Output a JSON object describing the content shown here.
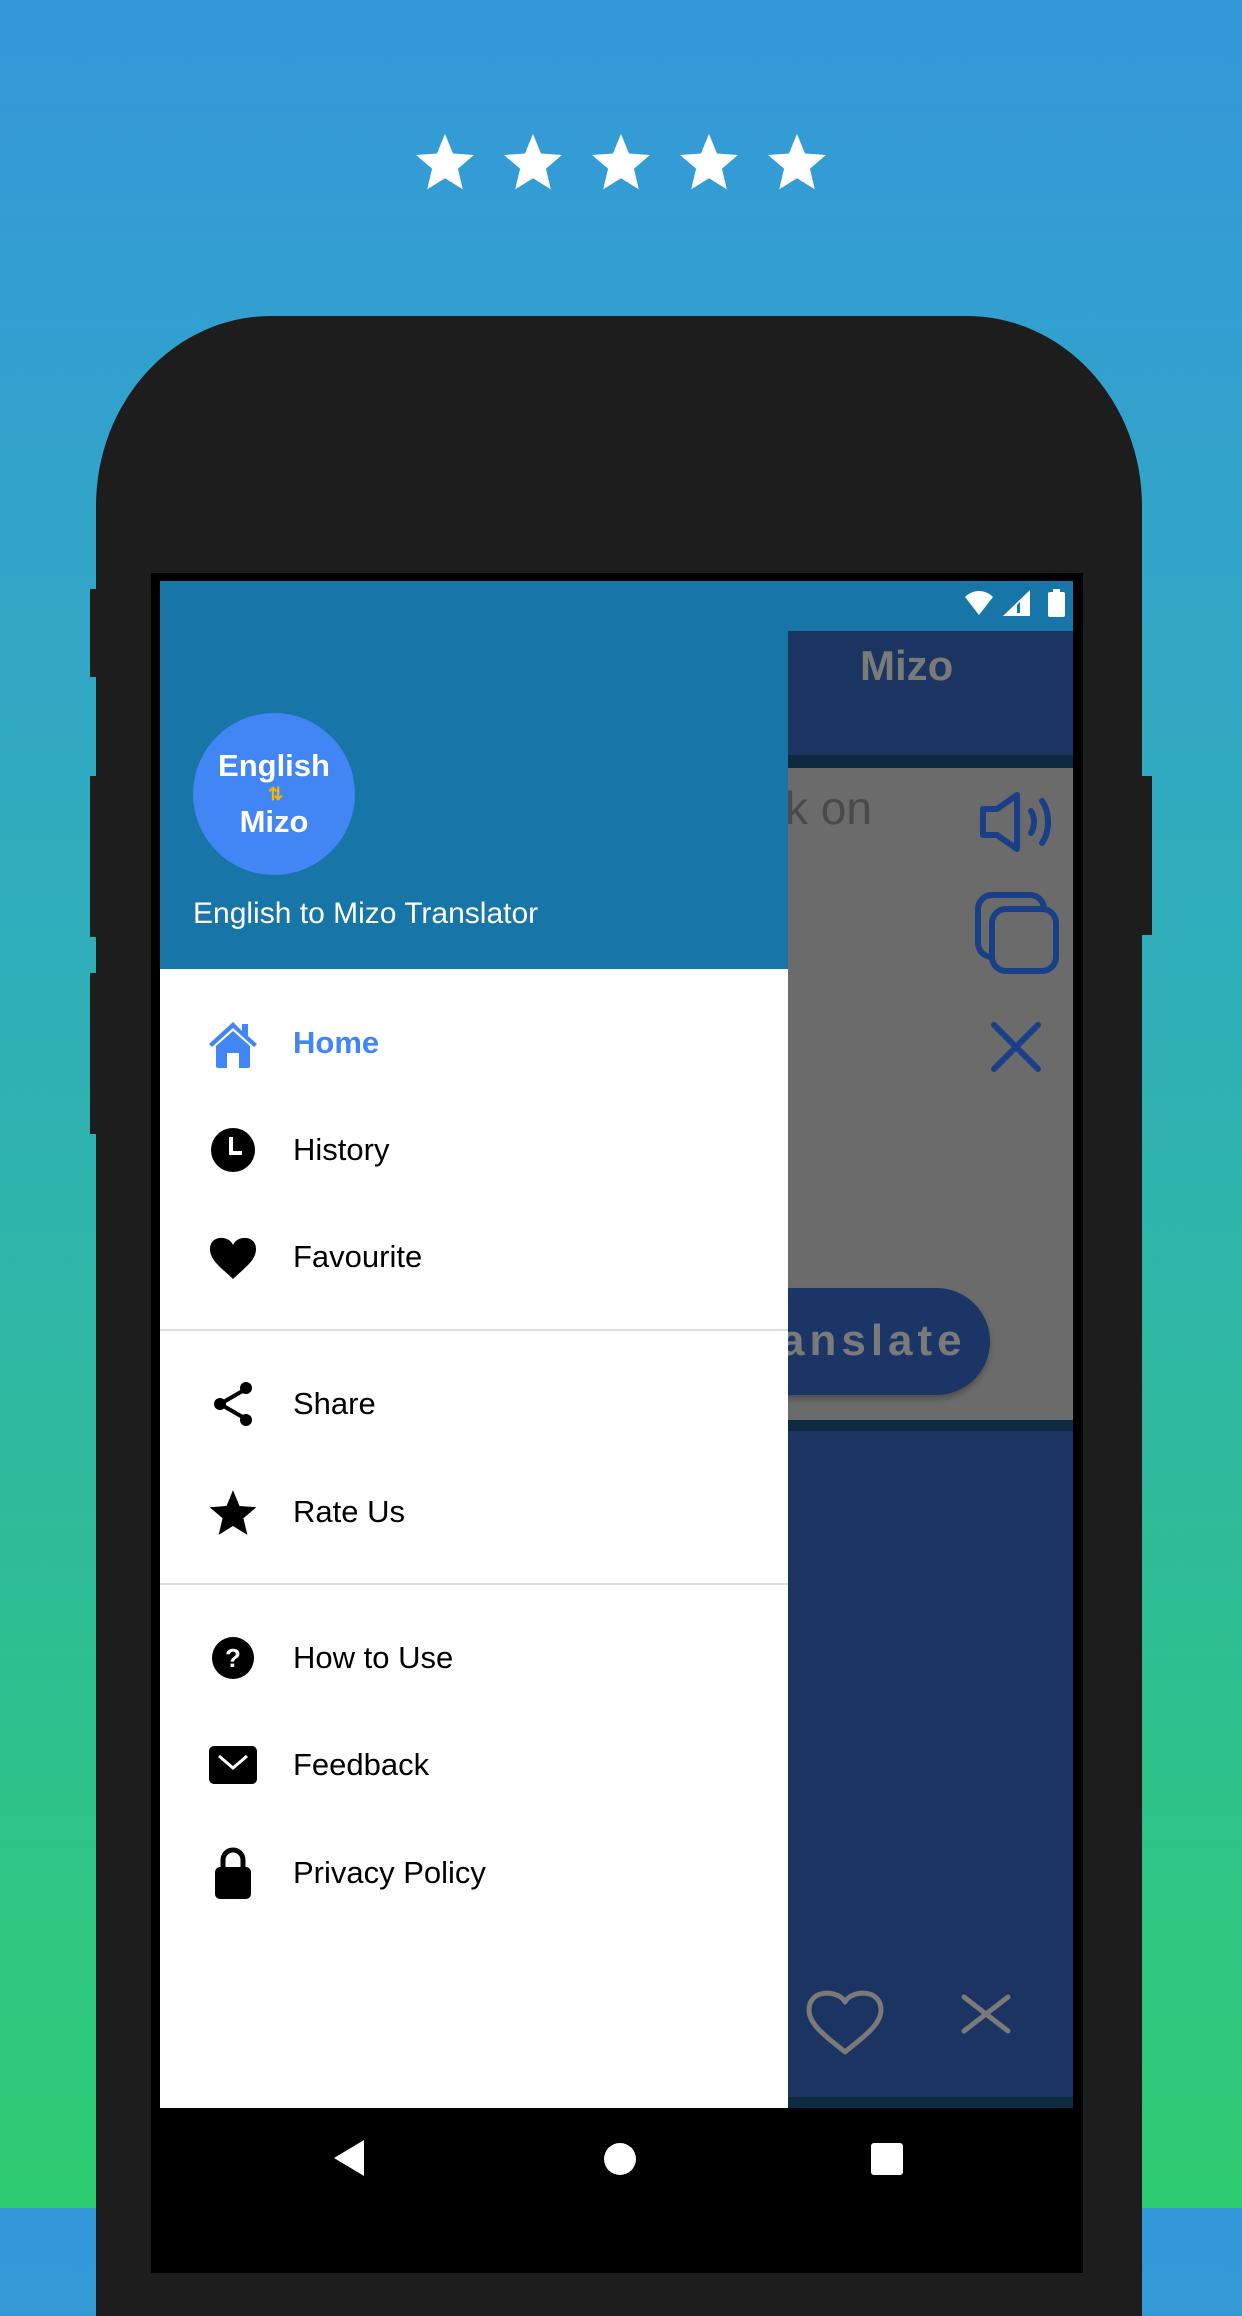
{
  "promo": {
    "rating_stars": 5,
    "star_color": "#FFFFFF"
  },
  "status_bar": {
    "icons": [
      "wifi-icon",
      "signal-icon",
      "battery-icon"
    ]
  },
  "app": {
    "app_bar_title_visible": "Mizo",
    "input_hint_visible": "k on",
    "translate_label_visible": "anslate",
    "input_actions": [
      "speaker-icon",
      "copy-icon",
      "clear-icon"
    ],
    "output_actions": [
      "favourite-outline-icon",
      "clear-icon"
    ],
    "colors": {
      "primary_dark": "#1775A8",
      "app_bar": "#1C3461",
      "action_icon": "#1B3F86"
    }
  },
  "drawer": {
    "avatar": {
      "line1": "English",
      "arrows": "⇅",
      "line2": "Mizo"
    },
    "subtitle": "English to Mizo Translator",
    "sections": [
      [
        {
          "label": "Home",
          "icon": "home-icon",
          "active": true
        },
        {
          "label": "History",
          "icon": "history-icon",
          "active": false
        },
        {
          "label": "Favourite",
          "icon": "heart-icon",
          "active": false
        }
      ],
      [
        {
          "label": "Share",
          "icon": "share-icon",
          "active": false
        },
        {
          "label": "Rate Us",
          "icon": "star-icon",
          "active": false
        }
      ],
      [
        {
          "label": "How to Use",
          "icon": "help-icon",
          "active": false
        },
        {
          "label": "Feedback",
          "icon": "mail-icon",
          "active": false
        },
        {
          "label": "Privacy Policy",
          "icon": "lock-icon",
          "active": false
        }
      ]
    ],
    "active_color": "#4285F4"
  },
  "nav_bar": {
    "buttons": [
      "back",
      "home",
      "recents"
    ]
  },
  "background": {
    "gradient_top": "#3498DB",
    "gradient_bottom": "#2ECC71"
  }
}
